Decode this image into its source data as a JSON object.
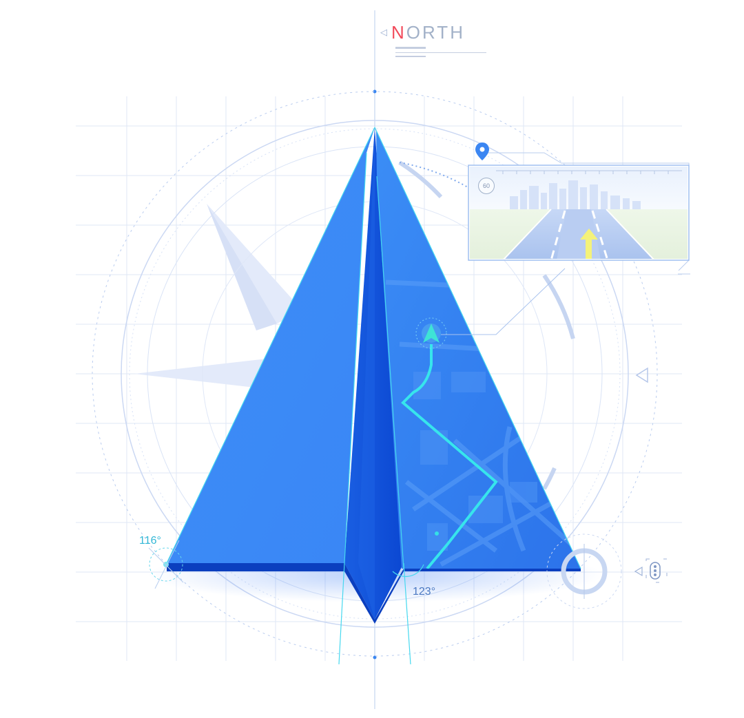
{
  "compass": {
    "north_initial": "N",
    "north_rest": "ORTH",
    "arrow_icon": "left-triangle-icon"
  },
  "angles": {
    "left": "116°",
    "right": "123°"
  },
  "nav_preview": {
    "speed_limit": "60",
    "pin_icon": "location-pin-icon",
    "arrow_icon": "direction-arrow-icon"
  },
  "colors": {
    "primary_blue": "#3a8ef8",
    "dark_blue": "#0e4bd6",
    "accent_cyan": "#2ee6e6",
    "north_red": "#f24b5b",
    "grid": "#d9e4f7",
    "road_arrow": "#f4f27a"
  }
}
